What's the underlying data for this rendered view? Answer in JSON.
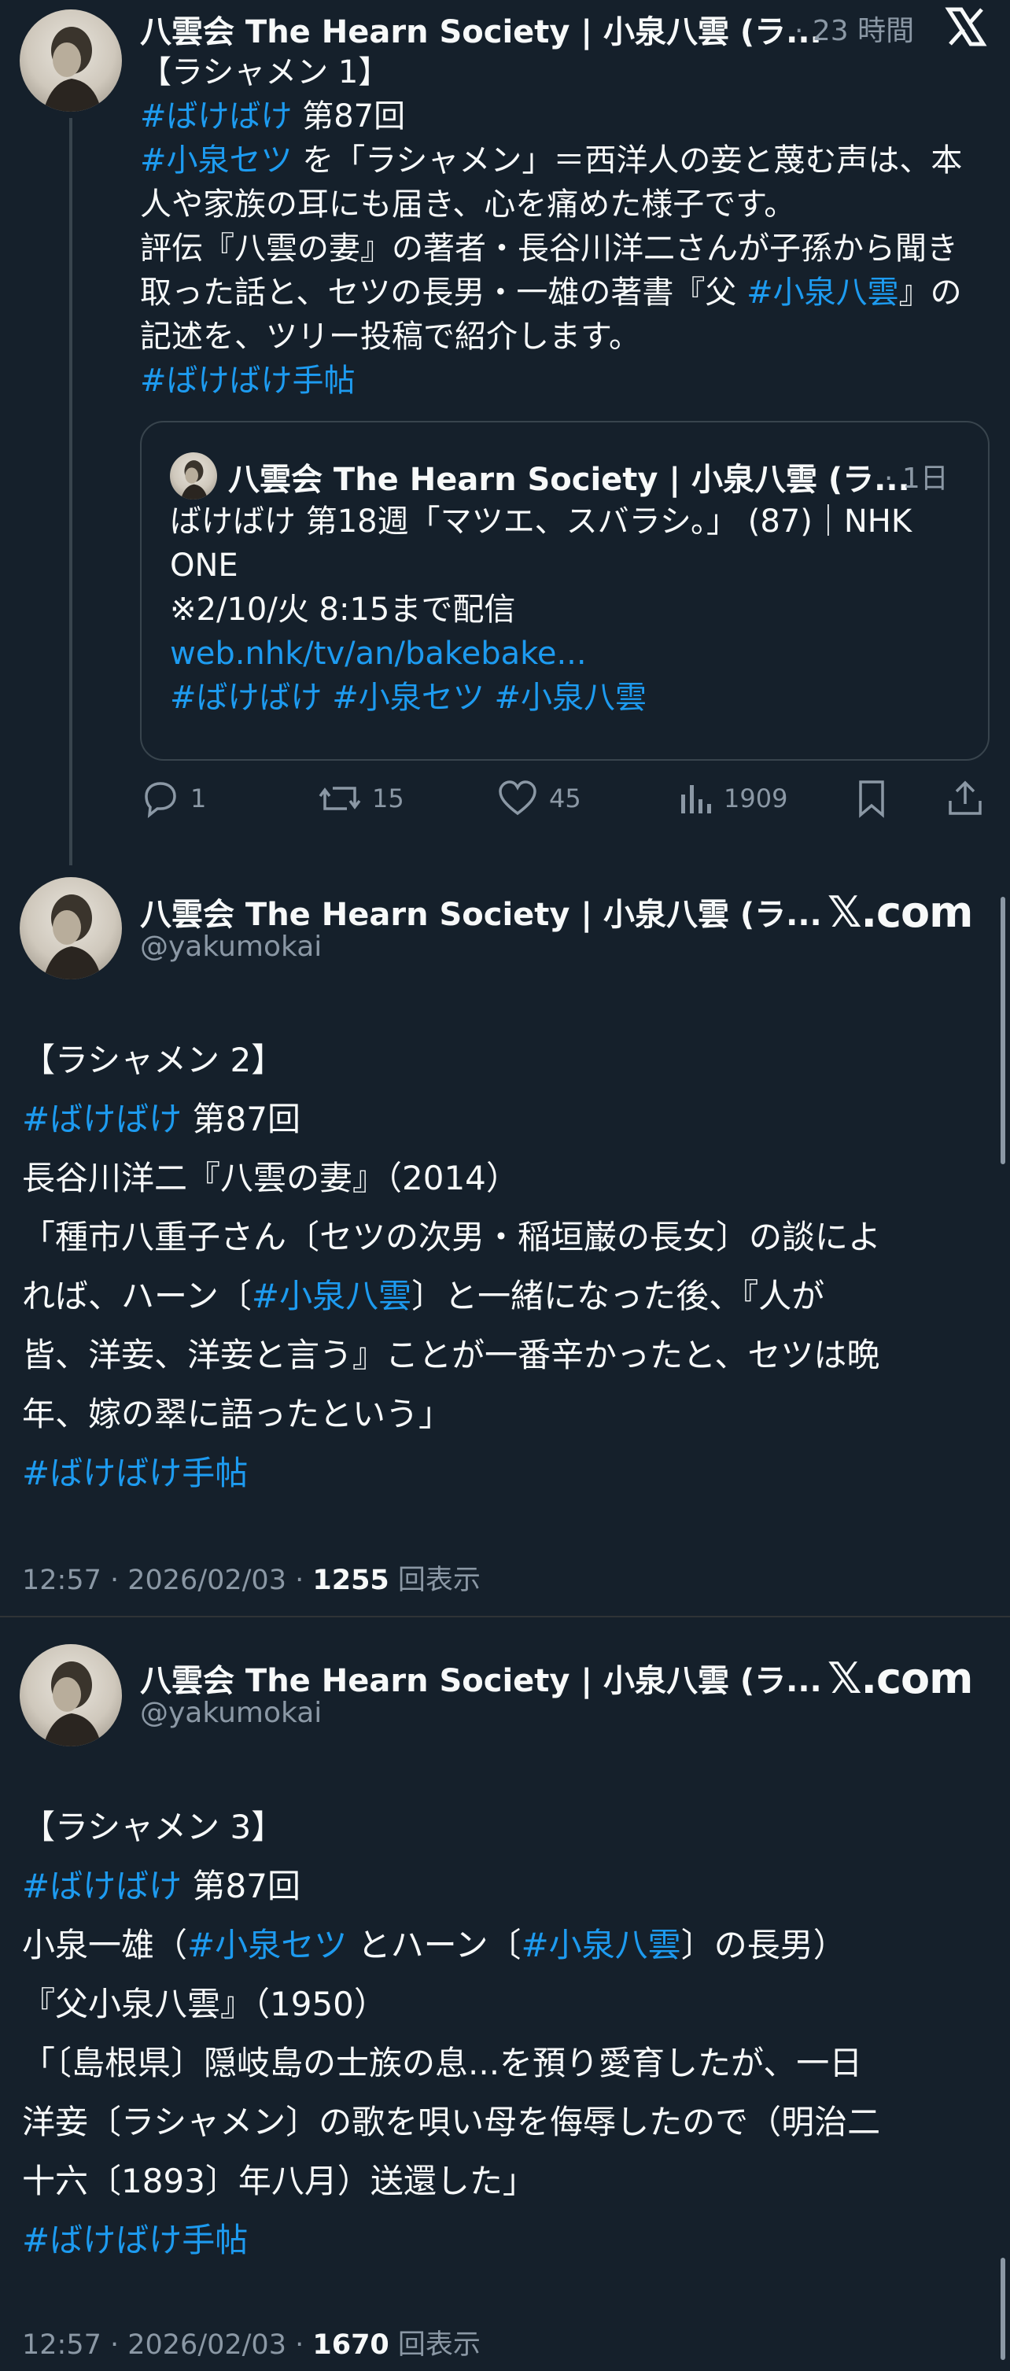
{
  "tweet1": {
    "author_name": "八雲会 The Hearn Society | 小泉八雲 (ラ...",
    "time": "· 23 時間",
    "lines": [
      [
        {
          "t": "【ラシャメン 1】"
        }
      ],
      [
        {
          "t": "#ばけばけ",
          "tag": true
        },
        {
          "t": " 第87回"
        }
      ],
      [
        {
          "t": "#小泉セツ",
          "tag": true
        },
        {
          "t": " を「ラシャメン」＝西洋人の妾と蔑む声は、本"
        }
      ],
      [
        {
          "t": "人や家族の耳にも届き、心を痛めた様子です。"
        }
      ],
      [
        {
          "t": "評伝『八雲の妻』の著者・長谷川洋二さんが子孫から聞き"
        }
      ],
      [
        {
          "t": "取った話と、セツの長男・一雄の著書『父 "
        },
        {
          "t": "#小泉八雲",
          "tag": true
        },
        {
          "t": "』の"
        }
      ],
      [
        {
          "t": "記述を、ツリー投稿で紹介します。"
        }
      ],
      [
        {
          "t": "#ばけばけ手帖",
          "tag": true
        }
      ]
    ],
    "quote": {
      "author_name": "八雲会 The Hearn Society | 小泉八雲 (ラ...",
      "time": "· 1日",
      "lines": [
        [
          {
            "t": "ばけばけ 第18週「マツエ、スバラシ。」 (87)｜NHK"
          }
        ],
        [
          {
            "t": "ONE"
          }
        ],
        [
          {
            "t": "※2/10/火 8:15まで配信"
          }
        ],
        [
          {
            "t": "web.nhk/tv/an/bakebake...",
            "tag": true
          }
        ],
        [
          {
            "t": "#ばけばけ #小泉セツ #小泉八雲",
            "tag": true
          }
        ]
      ]
    },
    "actions": {
      "replies": "1",
      "reposts": "15",
      "likes": "45",
      "views": "1909"
    }
  },
  "tweet2": {
    "author_name": "八雲会 The Hearn Society | 小泉八雲 (ラ...",
    "handle": "@yakumokai",
    "brand": "𝕏.com",
    "lines": [
      [
        {
          "t": "【ラシャメン 2】"
        }
      ],
      [
        {
          "t": "#ばけばけ",
          "tag": true
        },
        {
          "t": " 第87回"
        }
      ],
      [
        {
          "t": "長谷川洋二『八雲の妻』（2014）"
        }
      ],
      [
        {
          "t": "「種市八重子さん〔セツの次男・稲垣巌の長女〕の談によ"
        }
      ],
      [
        {
          "t": "れば、ハーン〔"
        },
        {
          "t": "#小泉八雲",
          "tag": true
        },
        {
          "t": "〕と一緒になった後、『人が"
        }
      ],
      [
        {
          "t": "皆、洋妾、洋妾と言う』ことが一番辛かったと、セツは晩"
        }
      ],
      [
        {
          "t": "年、嫁の翠に語ったという」"
        }
      ],
      [
        {
          "t": "#ばけばけ手帖",
          "tag": true
        }
      ]
    ],
    "footer": {
      "time": "12:57 · 2026/02/03 · ",
      "views": "1255",
      "views_label": " 回表示"
    }
  },
  "tweet3": {
    "author_name": "八雲会 The Hearn Society | 小泉八雲 (ラ...",
    "handle": "@yakumokai",
    "brand": "𝕏.com",
    "lines": [
      [
        {
          "t": "【ラシャメン 3】"
        }
      ],
      [
        {
          "t": "#ばけばけ",
          "tag": true
        },
        {
          "t": " 第87回"
        }
      ],
      [
        {
          "t": "小泉一雄（"
        },
        {
          "t": "#小泉セツ",
          "tag": true
        },
        {
          "t": " とハーン〔"
        },
        {
          "t": "#小泉八雲",
          "tag": true
        },
        {
          "t": "〕の長男）"
        }
      ],
      [
        {
          "t": "『父小泉八雲』（1950）"
        }
      ],
      [
        {
          "t": "「〔島根県〕隠岐島の士族の息...を預り愛育したが、一日"
        }
      ],
      [
        {
          "t": "洋妾〔ラシャメン〕の歌を唄い母を侮辱したので（明治二"
        }
      ],
      [
        {
          "t": "十六〔1893〕年八月）送還した」"
        }
      ],
      [
        {
          "t": "#ばけばけ手帖",
          "tag": true
        }
      ]
    ],
    "footer": {
      "time": "12:57 · 2026/02/03 · ",
      "views": "1670",
      "views_label": " 回表示"
    }
  },
  "colors": {
    "background": "#15202b",
    "link": "#1d9bf0",
    "muted": "#8b98a5",
    "border": "#38444d"
  }
}
